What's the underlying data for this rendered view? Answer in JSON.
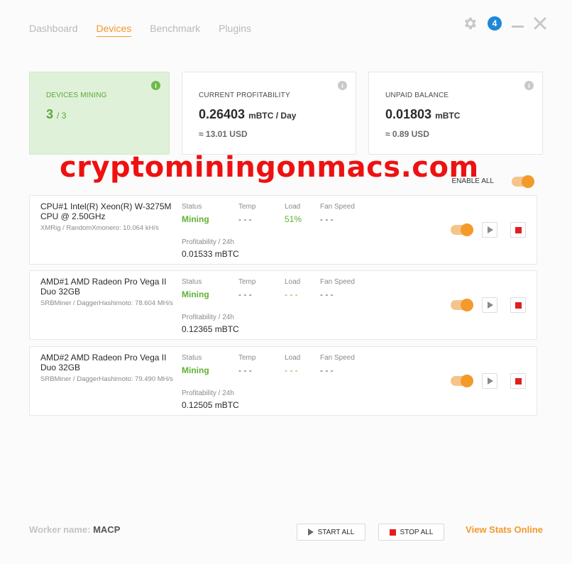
{
  "nav": {
    "tabs": [
      {
        "label": "Dashboard",
        "active": false
      },
      {
        "label": "Devices",
        "active": true
      },
      {
        "label": "Benchmark",
        "active": false
      },
      {
        "label": "Plugins",
        "active": false
      }
    ],
    "notification_count": "4"
  },
  "cards": {
    "devices_mining": {
      "label": "DEVICES MINING",
      "value": "3",
      "unit": "/ 3"
    },
    "profitability": {
      "label": "CURRENT PROFITABILITY",
      "value": "0.26403",
      "unit": "mBTC / Day",
      "sub": "≈ 13.01 USD"
    },
    "balance": {
      "label": "UNPAID BALANCE",
      "value": "0.01803",
      "unit": "mBTC",
      "sub": "≈ 0.89 USD"
    }
  },
  "watermark": "cryptominingonmacs.com",
  "enable_all_label": "ENABLE ALL",
  "columns": {
    "status": "Status",
    "temp": "Temp",
    "load": "Load",
    "fan": "Fan Speed",
    "profit": "Profitability / 24h"
  },
  "devices": [
    {
      "name": "CPU#1 Intel(R) Xeon(R) W-3275M CPU @ 2.50GHz",
      "algo": "XMRig / RandomXmonero: 10.064 kH/s",
      "status": "Mining",
      "temp": "- - -",
      "load": "51%",
      "fan": "- - -",
      "profit": "0.01533 mBTC"
    },
    {
      "name": "AMD#1 AMD Radeon Pro Vega II Duo 32GB",
      "algo": "SRBMiner / DaggerHashimoto: 78.604 MH/s",
      "status": "Mining",
      "temp": "- - -",
      "load": "- - -",
      "fan": "- - -",
      "profit": "0.12365 mBTC"
    },
    {
      "name": "AMD#2 AMD Radeon Pro Vega II Duo 32GB",
      "algo": "SRBMiner / DaggerHashimoto: 79.490 MH/s",
      "status": "Mining",
      "temp": "- - -",
      "load": "- - -",
      "fan": "- - -",
      "profit": "0.12505 mBTC"
    }
  ],
  "footer": {
    "worker_label": "Worker name:",
    "worker_name": "MACP",
    "start_all": "START ALL",
    "stop_all": "STOP ALL",
    "view_stats": "View Stats Online"
  },
  "colors": {
    "accent": "#f39a2b",
    "mining_green": "#5fb233",
    "stop_red": "#e02020",
    "badge_blue": "#1e88d6"
  },
  "icons": [
    "gear-icon",
    "minimize-icon",
    "close-icon",
    "info-icon",
    "play-icon",
    "stop-icon"
  ]
}
